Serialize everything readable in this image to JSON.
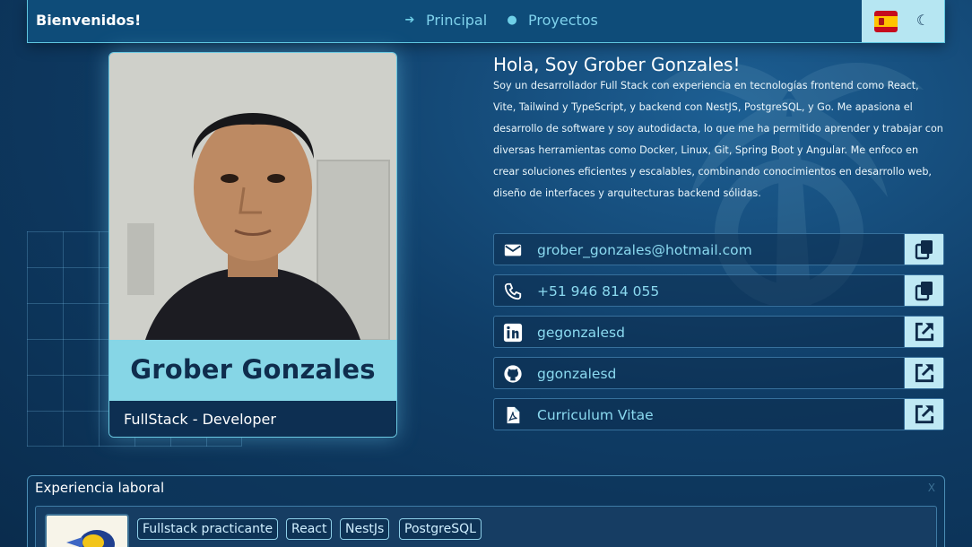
{
  "nav": {
    "welcome": "Bienvenidos!",
    "links": [
      {
        "label": "Principal",
        "icon": "arrow-right-icon"
      },
      {
        "label": "Proyectos",
        "icon": "dot-icon"
      }
    ],
    "language_flag": "spain-flag-icon",
    "theme_toggle": "moon-icon"
  },
  "profile": {
    "name": "Grober Gonzales",
    "role": "FullStack - Developer"
  },
  "about": {
    "title": "Hola, Soy Grober Gonzales!",
    "body": "Soy un desarrollador Full Stack con experiencia en tecnologías frontend como React, Vite, Tailwind y TypeScript, y backend con NestJS, PostgreSQL, y Go. Me apasiona el desarrollo de software y soy autodidacta, lo que me ha permitido aprender y trabajar con diversas herramientas como Docker, Linux, Git, Spring Boot y Angular. Me enfoco en crear soluciones eficientes y escalables, combinando conocimientos en desarrollo web, diseño de interfaces y arquitecturas backend sólidas."
  },
  "contacts": [
    {
      "text": "grober_gonzales@hotmail.com",
      "icon": "mail-icon",
      "action": "copy-icon"
    },
    {
      "text": "+51 946 814 055",
      "icon": "phone-icon",
      "action": "copy-icon"
    },
    {
      "text": "gegonzalesd",
      "icon": "linkedin-icon",
      "action": "external-link-icon"
    },
    {
      "text": "ggonzalesd",
      "icon": "github-icon",
      "action": "external-link-icon"
    },
    {
      "text": "Curriculum Vitae",
      "icon": "pdf-icon",
      "action": "external-link-icon"
    }
  ],
  "experience": {
    "title": "Experiencia laboral",
    "close": "X",
    "tags": [
      "Fullstack practicante",
      "React",
      "NestJs",
      "PostgreSQL"
    ]
  },
  "colors": {
    "background": "#0f3d67",
    "accent": "#86d6e6",
    "link": "#8bdaf0"
  }
}
